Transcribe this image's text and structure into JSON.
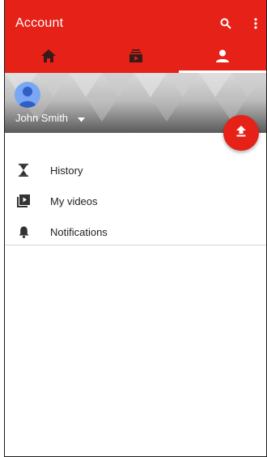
{
  "appbar": {
    "title": "Account",
    "search_icon": "search-icon",
    "more_icon": "more-vert-icon"
  },
  "tabs": [
    {
      "icon": "home-icon",
      "active": false
    },
    {
      "icon": "subscriptions-icon",
      "active": false
    },
    {
      "icon": "account-icon",
      "active": true
    }
  ],
  "account": {
    "name": "John Smith",
    "dropdown_icon": "caret-down-icon"
  },
  "fab": {
    "icon": "upload-icon"
  },
  "menu": [
    {
      "label": "History",
      "icon": "hourglass-icon"
    },
    {
      "label": "My videos",
      "icon": "video-library-icon"
    },
    {
      "label": "Notifications",
      "icon": "bell-icon"
    }
  ],
  "colors": {
    "brand_red": "#e62117",
    "avatar_blue": "#7aa7f4"
  }
}
